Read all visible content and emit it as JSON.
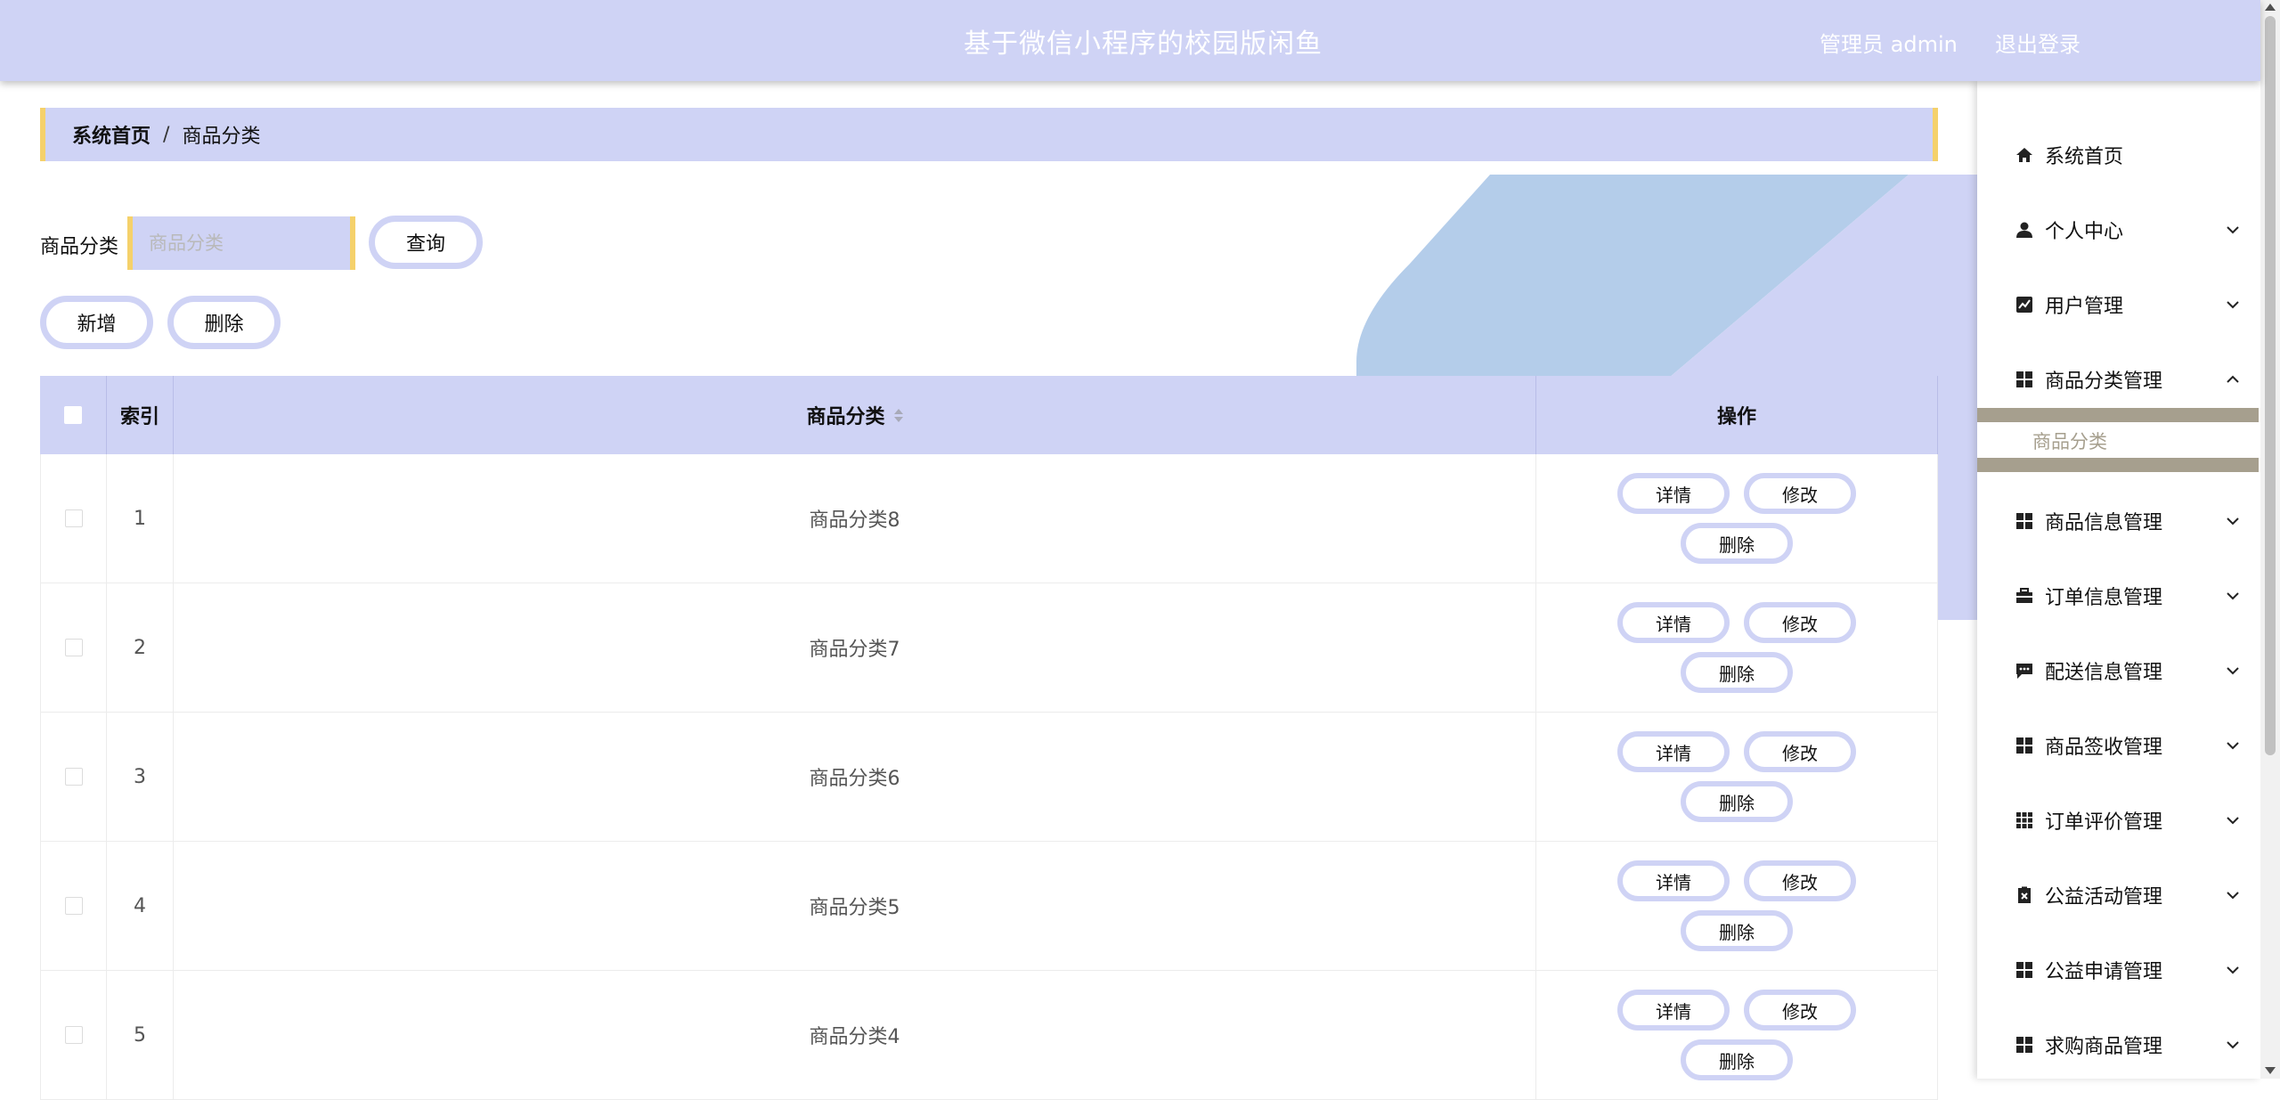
{
  "header": {
    "title": "基于微信小程序的校园版闲鱼",
    "user": "管理员 admin",
    "logout": "退出登录"
  },
  "breadcrumb": {
    "home": "系统首页",
    "separator": "/",
    "current": "商品分类"
  },
  "search": {
    "label": "商品分类",
    "placeholder": "商品分类",
    "query_button": "查询"
  },
  "actions": {
    "add": "新增",
    "delete": "删除"
  },
  "table": {
    "headers": {
      "index": "索引",
      "category": "商品分类",
      "operation": "操作"
    },
    "rows": [
      {
        "index": "1",
        "category": "商品分类8"
      },
      {
        "index": "2",
        "category": "商品分类7"
      },
      {
        "index": "3",
        "category": "商品分类6"
      },
      {
        "index": "4",
        "category": "商品分类5"
      },
      {
        "index": "5",
        "category": "商品分类4"
      }
    ],
    "row_buttons": {
      "detail": "详情",
      "edit": "修改",
      "delete": "删除"
    }
  },
  "sidebar": {
    "items": [
      {
        "label": "系统首页",
        "icon": "home-icon"
      },
      {
        "label": "个人中心",
        "icon": "user-icon"
      },
      {
        "label": "用户管理",
        "icon": "chart-icon"
      },
      {
        "label": "商品分类管理",
        "icon": "grid-icon"
      },
      {
        "label": "商品信息管理",
        "icon": "grid-icon"
      },
      {
        "label": "订单信息管理",
        "icon": "briefcase-icon"
      },
      {
        "label": "配送信息管理",
        "icon": "chat-icon"
      },
      {
        "label": "商品签收管理",
        "icon": "grid-icon"
      },
      {
        "label": "订单评价管理",
        "icon": "apps-icon"
      },
      {
        "label": "公益活动管理",
        "icon": "clipboard-icon"
      },
      {
        "label": "公益申请管理",
        "icon": "grid-icon"
      },
      {
        "label": "求购商品管理",
        "icon": "grid-icon"
      }
    ],
    "submenu": {
      "label": "商品分类"
    }
  },
  "colors": {
    "accent": "#cfd3f5",
    "highlight": "#f5d16b",
    "submenu_bar": "#a69f8e",
    "decor": "#b4cdea"
  }
}
